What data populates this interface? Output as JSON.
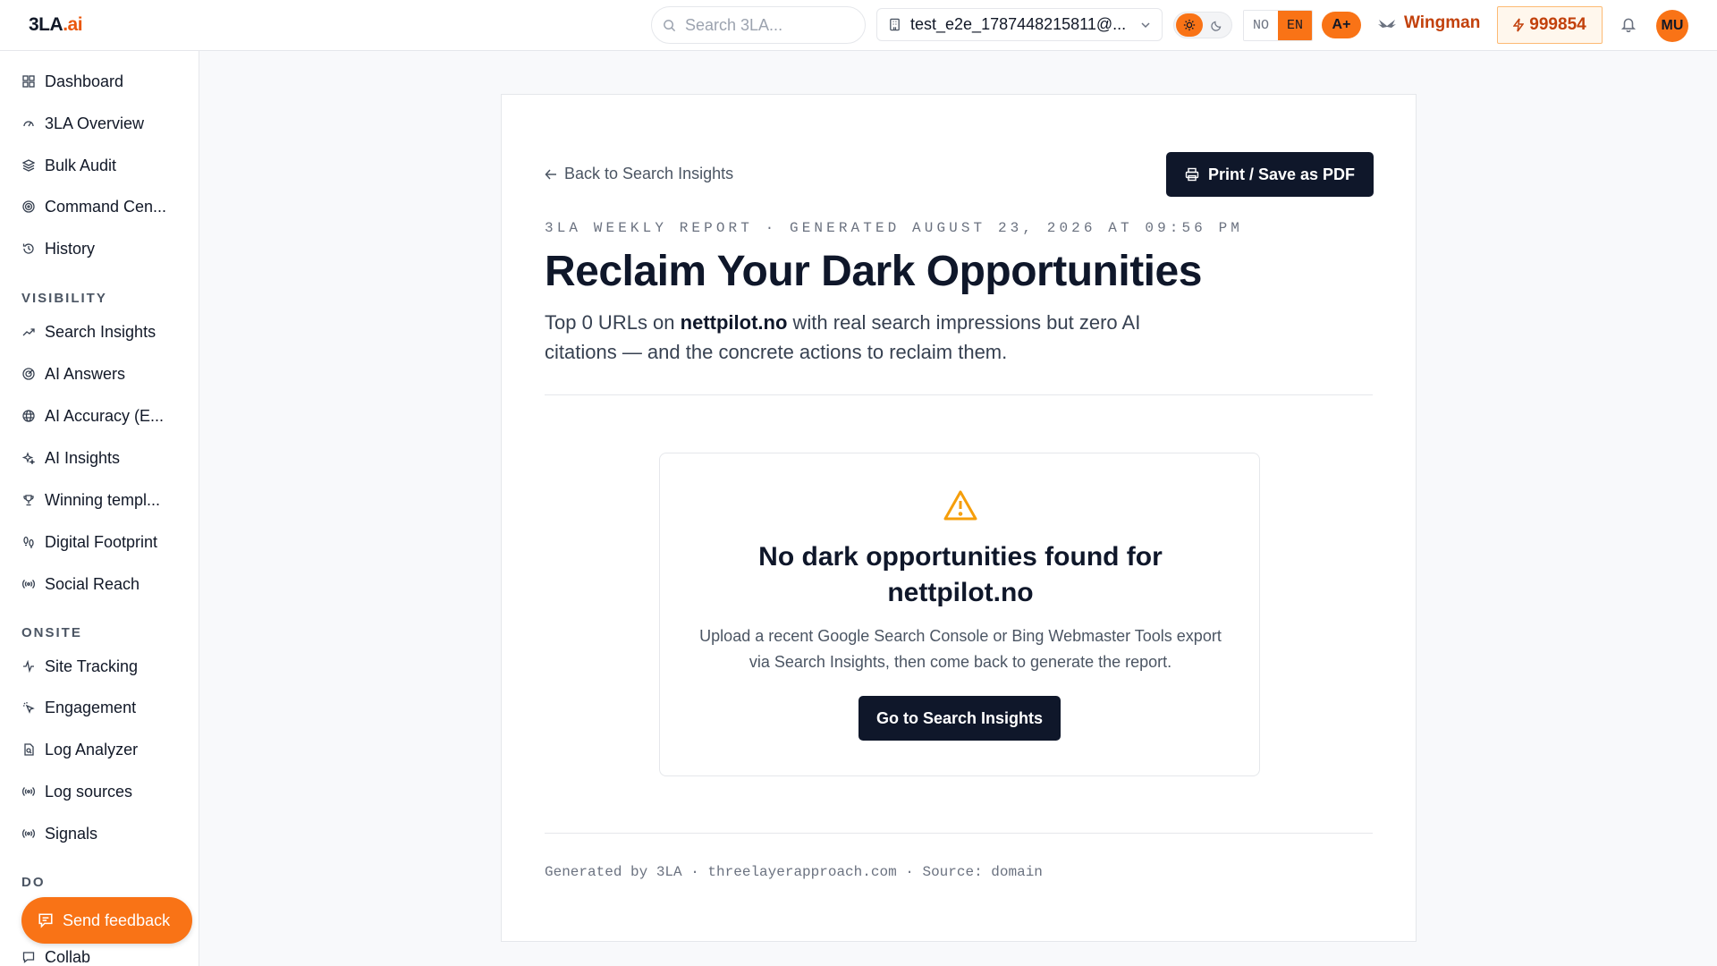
{
  "header": {
    "logo_main": "3LA",
    "logo_suffix": ".ai",
    "search_placeholder": "Search 3LA...",
    "account": "test_e2e_1787448215811@...",
    "lang_no": "NO",
    "lang_en": "EN",
    "a_plus": "A+",
    "wingman": "Wingman",
    "credits": "999854",
    "avatar": "MU"
  },
  "sidebar": {
    "top_items": [
      {
        "label": "Dashboard",
        "icon": "grid-icon"
      },
      {
        "label": "3LA Overview",
        "icon": "gauge-icon"
      },
      {
        "label": "Bulk Audit",
        "icon": "layers-icon"
      },
      {
        "label": "Command Cen...",
        "icon": "target-icon"
      },
      {
        "label": "History",
        "icon": "history-icon"
      }
    ],
    "visibility_label": "VISIBILITY",
    "visibility_items": [
      {
        "label": "Search Insights",
        "icon": "trending-up-icon"
      },
      {
        "label": "AI Answers",
        "icon": "radar-icon"
      },
      {
        "label": "AI Accuracy (E...",
        "icon": "globe-icon"
      },
      {
        "label": "AI Insights",
        "icon": "sparkles-icon"
      },
      {
        "label": "Winning templ...",
        "icon": "trophy-icon"
      },
      {
        "label": "Digital Footprint",
        "icon": "footprints-icon"
      },
      {
        "label": "Social Reach",
        "icon": "broadcast-icon"
      }
    ],
    "onsite_label": "ONSITE",
    "onsite_items": [
      {
        "label": "Site Tracking",
        "icon": "activity-icon"
      },
      {
        "label": "Engagement",
        "icon": "pointer-icon"
      },
      {
        "label": "Log Analyzer",
        "icon": "file-scan-icon"
      },
      {
        "label": "Log sources",
        "icon": "broadcast-icon"
      },
      {
        "label": "Signals",
        "icon": "broadcast-icon"
      }
    ],
    "do_label": "DO",
    "do_items": [
      {
        "label": "Collab",
        "icon": "message-icon"
      }
    ],
    "feedback": "Send feedback"
  },
  "report": {
    "back": "Back to Search Insights",
    "print": "Print / Save as PDF",
    "meta": "3LA WEEKLY REPORT · GENERATED AUGUST 23, 2026 AT 09:56 PM",
    "title": "Reclaim Your Dark Opportunities",
    "subtitle_pre": "Top 0 URLs on ",
    "subtitle_domain": "nettpilot.no",
    "subtitle_post": " with real search impressions but zero AI citations — and the concrete actions to reclaim them.",
    "empty_title": "No dark opportunities found for nettpilot.no",
    "empty_text": "Upload a recent Google Search Console or Bing Webmaster Tools export via Search Insights, then come back to generate the report.",
    "empty_button": "Go to Search Insights",
    "footer": "Generated by 3LA · threelayerapproach.com · Source: domain"
  },
  "colors": {
    "accent": "#f97316",
    "accent_dark": "#c2410c",
    "ink": "#0f172a",
    "warning": "#f59e0b"
  }
}
